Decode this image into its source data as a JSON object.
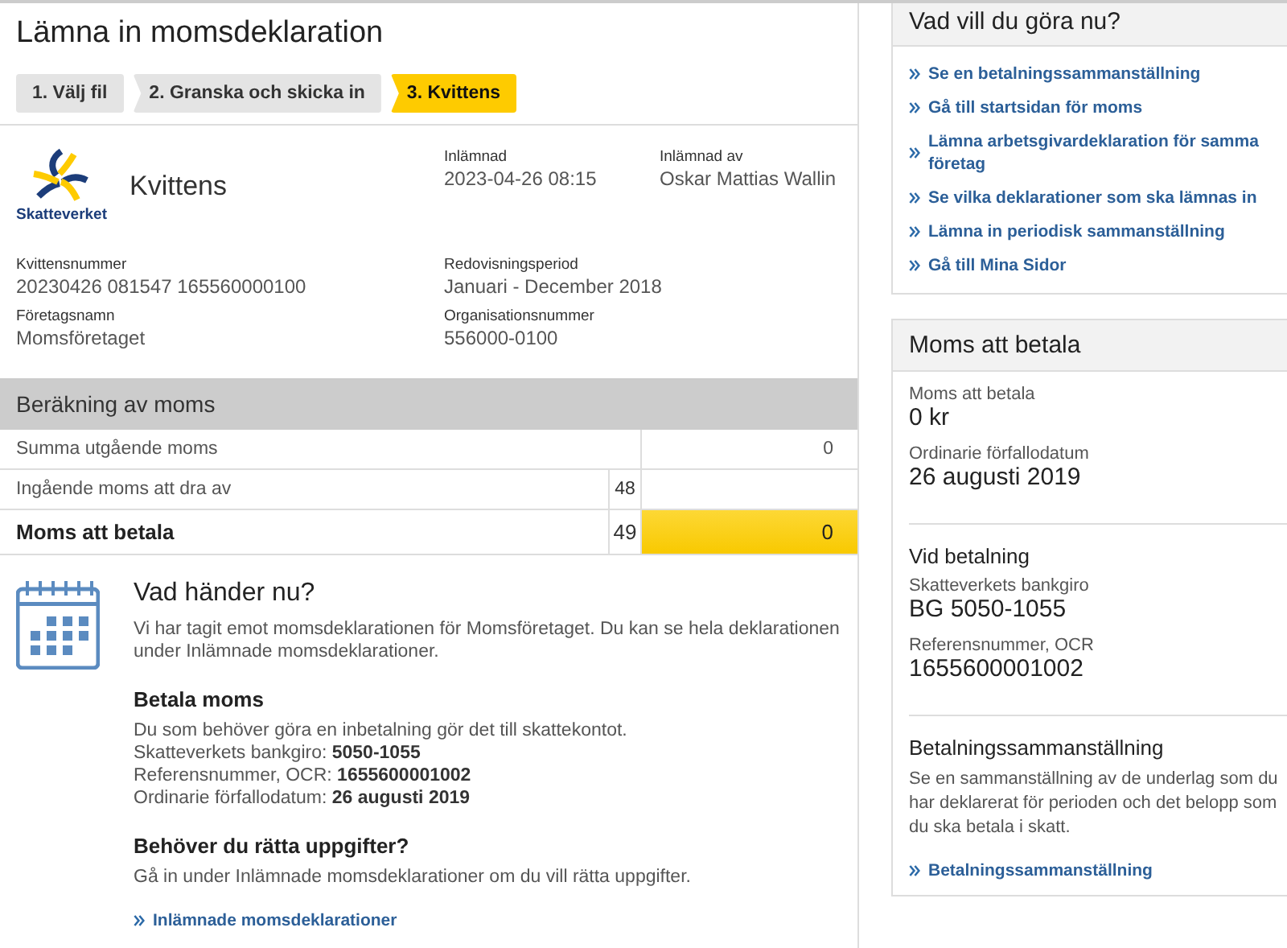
{
  "page_title": "Lämna in momsdeklaration",
  "steps": [
    {
      "label": "1. Välj fil",
      "selected": false
    },
    {
      "label": "2. Granska och skicka in",
      "selected": false
    },
    {
      "label": "3. Kvittens",
      "selected": true
    }
  ],
  "receipt": {
    "logo_text": "Skatteverket",
    "title": "Kvittens",
    "fields": [
      {
        "label": "Inlämnad",
        "value": "2023-04-26 08:15"
      },
      {
        "label": "Inlämnad av",
        "value": "Oskar Mattias Wallin"
      },
      {
        "label": "Kvittensnummer",
        "value": "20230426 081547 165560000100"
      },
      {
        "label": "Redovisningsperiod",
        "value": "Januari - December 2018"
      },
      {
        "label": "Företagsnamn",
        "value": "Momsföretaget"
      },
      {
        "label": "Organisationsnummer",
        "value": "556000-0100"
      }
    ]
  },
  "calculation": {
    "title": "Beräkning av moms",
    "rows": [
      {
        "kind": "plain",
        "label": "Summa utgående moms",
        "value": "0"
      },
      {
        "kind": "plain",
        "label": "Ingående moms att dra av",
        "code": "48"
      },
      {
        "kind": "total",
        "label": "Moms att betala",
        "code": "49",
        "value": "0"
      }
    ]
  },
  "next_steps": {
    "title": "Vad händer nu?",
    "intro": "Vi har tagit emot momsdeklarationen för Momsföretaget. Du kan se hela deklarationen under Inlämnade momsdeklarationer.",
    "sections": [
      {
        "heading": "Betala moms",
        "lines": [
          "Du som behöver göra en inbetalning gör det till skattekontot.",
          "Skatteverkets bankgiro: **5050-1055**",
          "Referensnummer, OCR: **1655600001002**",
          "Ordinarie förfallodatum: **26 augusti 2019**"
        ]
      },
      {
        "heading": "Behöver du rätta uppgifter?",
        "lines": [
          "Gå in under Inlämnade momsdeklarationer om du vill rätta uppgifter."
        ]
      }
    ],
    "link": "Inlämnade momsdeklarationer"
  },
  "actions": {
    "title": "Vad vill du göra nu?",
    "links": [
      "Se en betalningssammanställning",
      "Gå till startsidan för moms",
      "Lämna arbetsgivardeklaration för samma företag",
      "Se vilka deklarationer som ska lämnas in",
      "Lämna in periodisk sammanställning",
      "Gå till Mina Sidor"
    ]
  },
  "payment": {
    "title": "Moms att betala",
    "sections": [
      {
        "items": [
          {
            "label": "Moms att betala",
            "value": "0 kr"
          },
          {
            "label": "Ordinarie förfallodatum",
            "value": "26 augusti 2019"
          }
        ]
      },
      {
        "heading": "Vid betalning",
        "items": [
          {
            "label": "Skatteverkets bankgiro",
            "value": "BG 5050-1055"
          },
          {
            "label": "Referensnummer, OCR",
            "value": "1655600001002"
          }
        ]
      },
      {
        "heading": "Betalningssammanställning",
        "text": "Se en sammanställning av de underlag som du har deklarerat för perioden och det belopp som du ska betala i skatt.",
        "link": "Betalningssammanställning"
      }
    ]
  }
}
